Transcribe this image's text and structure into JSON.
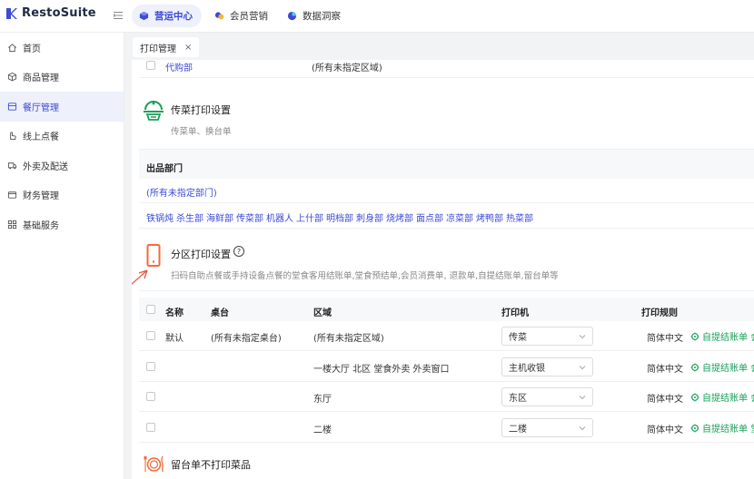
{
  "app": {
    "name": "RestoSuite"
  },
  "top_tabs": [
    {
      "label": "营运中心",
      "active": true
    },
    {
      "label": "会员营销",
      "active": false
    },
    {
      "label": "数据洞察",
      "active": false
    }
  ],
  "sidebar": {
    "items": [
      {
        "label": "首页",
        "icon": "home-icon",
        "active": false
      },
      {
        "label": "商品管理",
        "icon": "box-icon",
        "active": false
      },
      {
        "label": "餐厅管理",
        "icon": "restaurant-icon",
        "active": true
      },
      {
        "label": "线上点餐",
        "icon": "hand-icon",
        "active": false
      },
      {
        "label": "外卖及配送",
        "icon": "delivery-icon",
        "active": false
      },
      {
        "label": "财务管理",
        "icon": "wallet-icon",
        "active": false
      },
      {
        "label": "基础服务",
        "icon": "grid-icon",
        "active": false
      }
    ]
  },
  "page_tab": {
    "label": "打印管理",
    "close": "×"
  },
  "top_row": {
    "name": "代购部",
    "area": "(所有未指定区域)"
  },
  "serving_section": {
    "title": "传菜打印设置",
    "subtitle": "传菜单、换台单",
    "dept_header": "出品部门",
    "unassigned": "(所有未指定部门)",
    "departments": [
      "铁锅炖",
      "杀生部",
      "海鲜部",
      "传菜部",
      "机器人",
      "上什部",
      "明档部",
      "刺身部",
      "烧烤部",
      "面点部",
      "凉菜部",
      "烤鸭部",
      "热菜部"
    ]
  },
  "zone_section": {
    "title": "分区打印设置",
    "help": "?",
    "subtitle": "扫码自助点餐或手持设备点餐的堂食客用结账单,堂食预结单,会员消费单, 退款单,自提结账单,留台单等"
  },
  "table": {
    "headers": [
      "名称",
      "桌台",
      "区域",
      "打印机",
      "打印规则"
    ],
    "rows": [
      {
        "name": "默认",
        "table": "(所有未指定桌台)",
        "area": "(所有未指定区域)",
        "printer": "传菜",
        "lang": "简体中文",
        "rule": "自提结账单",
        "rule_more": "会"
      },
      {
        "name": "",
        "table": "",
        "area": "一楼大厅 北区 堂食外卖 外卖窗口",
        "printer": "主机收银",
        "lang": "简体中文",
        "rule": "自提结账单",
        "rule_more": "会"
      },
      {
        "name": "",
        "table": "",
        "area": "东厅",
        "printer": "东区",
        "lang": "简体中文",
        "rule": "自提结账单",
        "rule_more": "会"
      },
      {
        "name": "",
        "table": "",
        "area": "二楼",
        "printer": "二楼",
        "lang": "简体中文",
        "rule": "自提结账单",
        "rule_more": "堂"
      }
    ]
  },
  "bottom_section": {
    "title": "留台单不打印菜品"
  },
  "colors": {
    "accent": "#3d4bd6",
    "green": "#1aa05a",
    "orange": "#f26b3a",
    "arrow": "#e05a4b"
  }
}
